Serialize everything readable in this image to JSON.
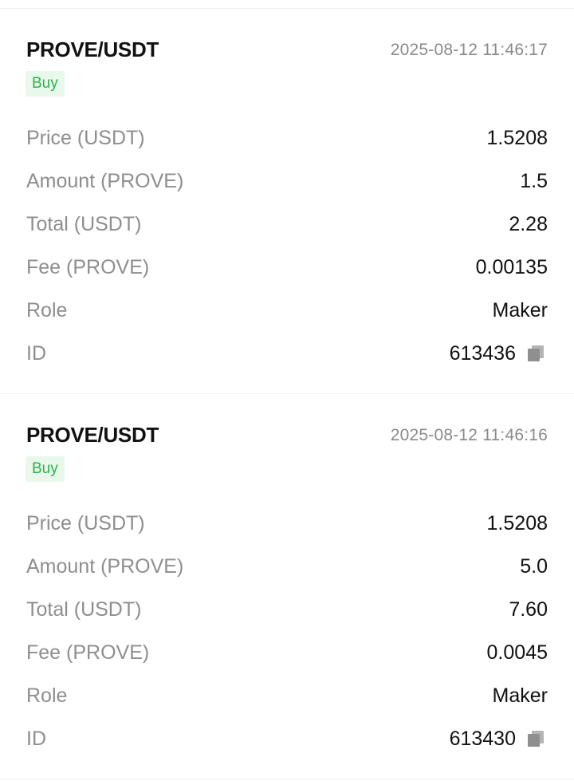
{
  "trades": [
    {
      "pair": "PROVE/USDT",
      "time": "2025-08-12 11:46:17",
      "side": "Buy",
      "rows": [
        {
          "label": "Price (USDT)",
          "value": "1.5208"
        },
        {
          "label": "Amount (PROVE)",
          "value": "1.5"
        },
        {
          "label": "Total (USDT)",
          "value": "2.28"
        },
        {
          "label": "Fee (PROVE)",
          "value": "0.00135"
        },
        {
          "label": "Role",
          "value": "Maker"
        },
        {
          "label": "ID",
          "value": "613436"
        }
      ]
    },
    {
      "pair": "PROVE/USDT",
      "time": "2025-08-12 11:46:16",
      "side": "Buy",
      "rows": [
        {
          "label": "Price (USDT)",
          "value": "1.5208"
        },
        {
          "label": "Amount (PROVE)",
          "value": "5.0"
        },
        {
          "label": "Total (USDT)",
          "value": "7.60"
        },
        {
          "label": "Fee (PROVE)",
          "value": "0.0045"
        },
        {
          "label": "Role",
          "value": "Maker"
        },
        {
          "label": "ID",
          "value": "613430"
        }
      ]
    }
  ],
  "colors": {
    "buy_text": "#2bb34a",
    "buy_bg": "#e8f8ea",
    "label": "#8e8e8e",
    "value": "#111111",
    "time": "#8a8a8a"
  },
  "icons": {
    "copy": "copy-icon"
  }
}
